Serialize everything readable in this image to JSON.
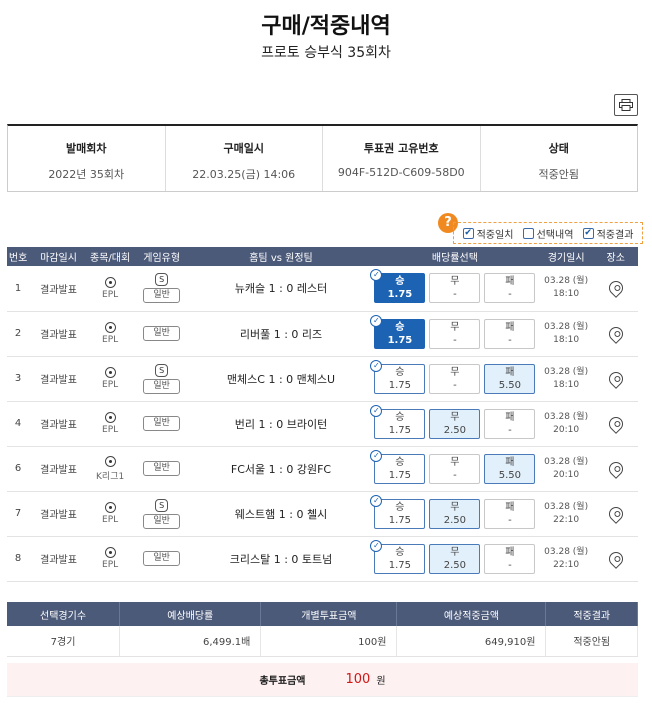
{
  "page": {
    "title": "구매/적중내역",
    "subtitle": "프로토 승부식 35회차"
  },
  "info": [
    {
      "label": "발매회차",
      "value": "2022년 35회차"
    },
    {
      "label": "구매일시",
      "value": "22.03.25(금) 14:06"
    },
    {
      "label": "투표권 고유번호",
      "value": "904F-512D-C609-58D0"
    },
    {
      "label": "상태",
      "value": "적중안됨"
    }
  ],
  "filters": [
    {
      "label": "적중일치",
      "checked": true
    },
    {
      "label": "선택내역",
      "checked": false
    },
    {
      "label": "적중결과",
      "checked": true
    }
  ],
  "help": "?",
  "columns": [
    "번호",
    "마감일시",
    "종목/대회",
    "게임유형",
    "홈팀 vs 원정팀",
    "배당률선택",
    "경기일시",
    "장소"
  ],
  "games": [
    {
      "no": "1",
      "close": "결과발표",
      "league": "EPL",
      "s": "S",
      "type": "일반",
      "match": "뉴캐슬 1 : 0 레스터",
      "odds": [
        {
          "label": "승",
          "value": "1.75",
          "state": "sel"
        },
        {
          "label": "무",
          "value": "-",
          "state": ""
        },
        {
          "label": "패",
          "value": "-",
          "state": ""
        }
      ],
      "date1": "03.28 (월)",
      "date2": "18:10"
    },
    {
      "no": "2",
      "close": "결과발표",
      "league": "EPL",
      "s": "",
      "type": "일반",
      "match": "리버풀 1 : 0 리즈",
      "odds": [
        {
          "label": "승",
          "value": "1.75",
          "state": "sel"
        },
        {
          "label": "무",
          "value": "-",
          "state": ""
        },
        {
          "label": "패",
          "value": "-",
          "state": ""
        }
      ],
      "date1": "03.28 (월)",
      "date2": "18:10"
    },
    {
      "no": "3",
      "close": "결과발표",
      "league": "EPL",
      "s": "S",
      "type": "일반",
      "match": "맨체스C 1 : 0 맨체스U",
      "odds": [
        {
          "label": "승",
          "value": "1.75",
          "state": "pick"
        },
        {
          "label": "무",
          "value": "-",
          "state": ""
        },
        {
          "label": "패",
          "value": "5.50",
          "state": "hit"
        }
      ],
      "date1": "03.28 (월)",
      "date2": "18:10"
    },
    {
      "no": "4",
      "close": "결과발표",
      "league": "EPL",
      "s": "",
      "type": "일반",
      "match": "번리 1 : 0 브라이턴",
      "odds": [
        {
          "label": "승",
          "value": "1.75",
          "state": "pick"
        },
        {
          "label": "무",
          "value": "2.50",
          "state": "hit"
        },
        {
          "label": "패",
          "value": "-",
          "state": ""
        }
      ],
      "date1": "03.28 (월)",
      "date2": "20:10"
    },
    {
      "no": "6",
      "close": "결과발표",
      "league": "K리그1",
      "s": "",
      "type": "일반",
      "match": "FC서울 1 : 0 강원FC",
      "odds": [
        {
          "label": "승",
          "value": "1.75",
          "state": "pick"
        },
        {
          "label": "무",
          "value": "-",
          "state": ""
        },
        {
          "label": "패",
          "value": "5.50",
          "state": "hit"
        }
      ],
      "date1": "03.28 (월)",
      "date2": "20:10"
    },
    {
      "no": "7",
      "close": "결과발표",
      "league": "EPL",
      "s": "S",
      "type": "일반",
      "match": "웨스트햄 1 : 0 첼시",
      "odds": [
        {
          "label": "승",
          "value": "1.75",
          "state": "pick"
        },
        {
          "label": "무",
          "value": "2.50",
          "state": "hit"
        },
        {
          "label": "패",
          "value": "-",
          "state": ""
        }
      ],
      "date1": "03.28 (월)",
      "date2": "22:10"
    },
    {
      "no": "8",
      "close": "결과발표",
      "league": "EPL",
      "s": "",
      "type": "일반",
      "match": "크리스탈 1 : 0 토트넘",
      "odds": [
        {
          "label": "승",
          "value": "1.75",
          "state": "pick"
        },
        {
          "label": "무",
          "value": "2.50",
          "state": "hit"
        },
        {
          "label": "패",
          "value": "-",
          "state": ""
        }
      ],
      "date1": "03.28 (월)",
      "date2": "22:10"
    }
  ],
  "summary": {
    "headers": [
      "선택경기수",
      "예상배당률",
      "개별투표금액",
      "예상적중금액",
      "적중결과"
    ],
    "values": [
      "7경기",
      "6,499.1배",
      "100원",
      "649,910원",
      "적중안됨"
    ]
  },
  "total": {
    "label": "총투표금액",
    "amount": "100",
    "unit": "원"
  },
  "colors": {
    "header": "#4c5a7a",
    "selected": "#1d63b4",
    "hit_bg": "#e2f0fb",
    "accent": "#f08a20",
    "total_red": "#d01818"
  }
}
